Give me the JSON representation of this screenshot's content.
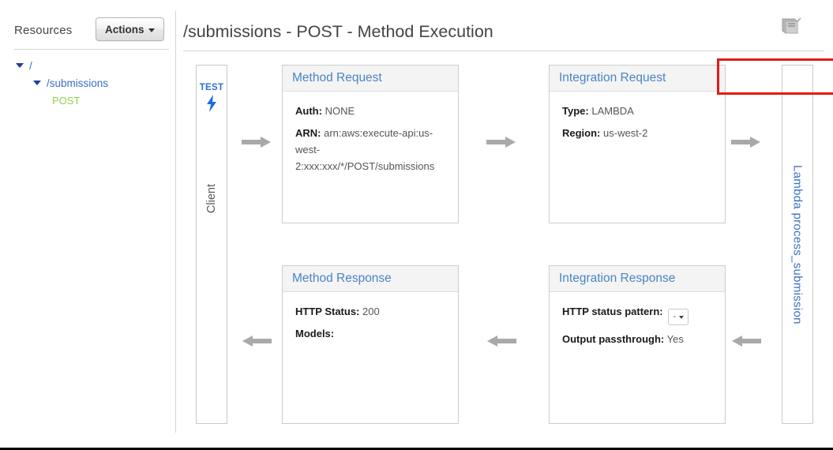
{
  "sidebar": {
    "title": "Resources",
    "actions_label": "Actions",
    "tree": [
      {
        "label": "/",
        "type": "resource",
        "expanded": true,
        "level": 1
      },
      {
        "label": "/submissions",
        "type": "resource",
        "expanded": true,
        "level": 2
      },
      {
        "label": "POST",
        "type": "method",
        "expanded": false,
        "level": 3
      }
    ]
  },
  "header": {
    "title": "/submissions - POST - Method Execution",
    "doc_icon": "book-icon"
  },
  "diagram": {
    "client_column": {
      "test_label": "TEST",
      "test_icon": "lightning-bolt-icon",
      "label": "Client"
    },
    "lambda_column": {
      "label": "Lambda process_submission"
    },
    "panels": [
      {
        "id": "method-request",
        "title": "Method Request",
        "highlighted": false,
        "rows": [
          {
            "label": "Auth:",
            "value": "NONE"
          },
          {
            "label": "ARN:",
            "value": "arn:aws:execute-api:us-west-2:xxx:xxx/*/POST/submissions"
          }
        ]
      },
      {
        "id": "integration-request",
        "title": "Integration Request",
        "highlighted": true,
        "rows": [
          {
            "label": "Type:",
            "value": "LAMBDA"
          },
          {
            "label": "Region:",
            "value": "us-west-2"
          }
        ]
      },
      {
        "id": "method-response",
        "title": "Method Response",
        "highlighted": false,
        "rows": [
          {
            "label": "HTTP Status:",
            "value": "200"
          },
          {
            "label": "Models:",
            "value": ""
          }
        ]
      },
      {
        "id": "integration-response",
        "title": "Integration Response",
        "highlighted": false,
        "rows": [
          {
            "label": "HTTP status pattern:",
            "value": "-",
            "control": "dropdown"
          },
          {
            "label": "Output passthrough:",
            "value": "Yes"
          }
        ]
      }
    ],
    "arrows": [
      {
        "direction": "right"
      },
      {
        "direction": "right"
      },
      {
        "direction": "right"
      },
      {
        "direction": "left"
      },
      {
        "direction": "left"
      },
      {
        "direction": "left"
      }
    ]
  },
  "colors": {
    "link_blue": "#3b6fc4",
    "panel_title_blue": "#4a84c4",
    "method_green": "#8fd14f",
    "highlight_red": "#e41b13",
    "arrow_gray": "#a9a9a9",
    "test_blue": "#2a6fd4"
  }
}
